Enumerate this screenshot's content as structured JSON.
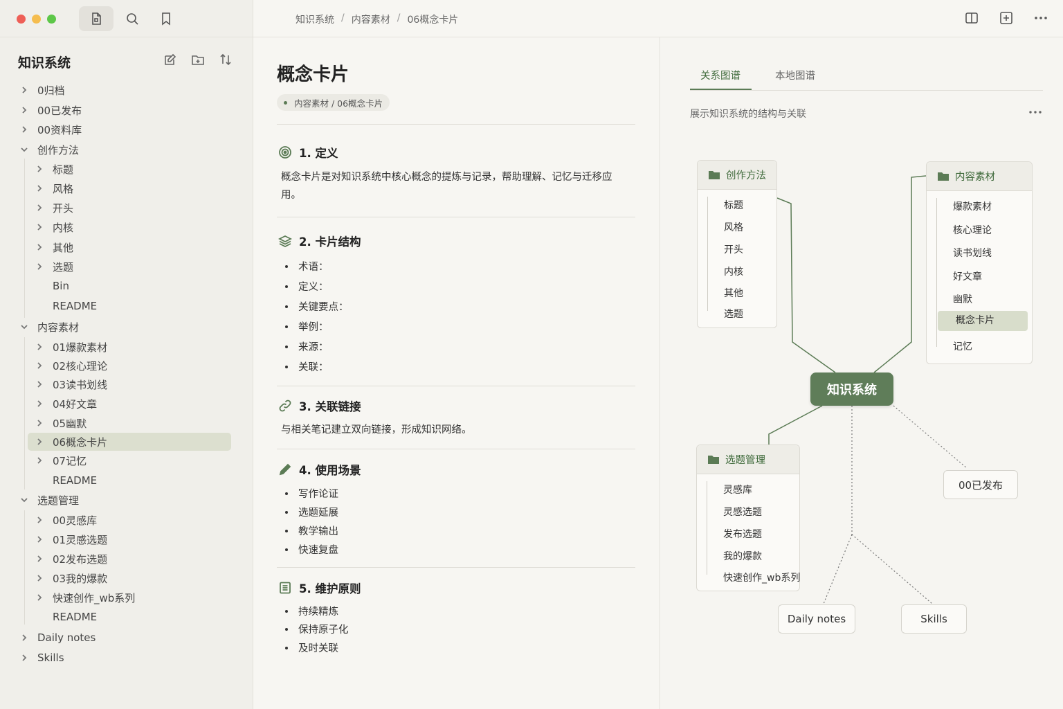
{
  "window": {
    "active_tool": "file-explorer"
  },
  "breadcrumb": [
    "知识系统",
    "内容素材",
    "06概念卡片"
  ],
  "sidebar": {
    "vault_title": "知识系统",
    "tree": [
      {
        "label": "0归档",
        "depth": 0,
        "chevron": "right"
      },
      {
        "label": "00已发布",
        "depth": 0,
        "chevron": "right"
      },
      {
        "label": "00资料库",
        "depth": 0,
        "chevron": "right"
      },
      {
        "label": "创作方法",
        "depth": 0,
        "chevron": "down"
      },
      {
        "label": "标题",
        "depth": 1,
        "chevron": "right"
      },
      {
        "label": "风格",
        "depth": 1,
        "chevron": "right"
      },
      {
        "label": "开头",
        "depth": 1,
        "chevron": "right"
      },
      {
        "label": "内核",
        "depth": 1,
        "chevron": "right"
      },
      {
        "label": "其他",
        "depth": 1,
        "chevron": "right"
      },
      {
        "label": "选题",
        "depth": 1,
        "chevron": "right"
      },
      {
        "label": "Bin",
        "depth": 1,
        "chevron": "none"
      },
      {
        "label": "README",
        "depth": 1,
        "chevron": "none"
      },
      {
        "label": "内容素材",
        "depth": 0,
        "chevron": "down"
      },
      {
        "label": "01爆款素材",
        "depth": 1,
        "chevron": "right"
      },
      {
        "label": "02核心理论",
        "depth": 1,
        "chevron": "right"
      },
      {
        "label": "03读书划线",
        "depth": 1,
        "chevron": "right"
      },
      {
        "label": "04好文章",
        "depth": 1,
        "chevron": "right"
      },
      {
        "label": "05幽默",
        "depth": 1,
        "chevron": "right"
      },
      {
        "label": "06概念卡片",
        "depth": 1,
        "chevron": "right",
        "selected": true
      },
      {
        "label": "07记忆",
        "depth": 1,
        "chevron": "right"
      },
      {
        "label": "README",
        "depth": 1,
        "chevron": "none"
      },
      {
        "label": "选题管理",
        "depth": 0,
        "chevron": "down"
      },
      {
        "label": "00灵感库",
        "depth": 1,
        "chevron": "right"
      },
      {
        "label": "01灵感选题",
        "depth": 1,
        "chevron": "right"
      },
      {
        "label": "02发布选题",
        "depth": 1,
        "chevron": "right"
      },
      {
        "label": "03我的爆款",
        "depth": 1,
        "chevron": "right"
      },
      {
        "label": "快速创作_wb系列",
        "depth": 1,
        "chevron": "right"
      },
      {
        "label": "README",
        "depth": 1,
        "chevron": "none"
      },
      {
        "label": "Daily notes",
        "depth": 0,
        "chevron": "right"
      },
      {
        "label": "Skills",
        "depth": 0,
        "chevron": "right"
      }
    ]
  },
  "note": {
    "title": "概念卡片",
    "path_pill": "内容素材 / 06概念卡片",
    "sections": [
      {
        "heading": "1. 定义",
        "icon": "target-icon",
        "text": "概念卡片是对知识系统中核心概念的提炼与记录，帮助理解、记忆与迁移应用。"
      },
      {
        "heading": "2. 卡片结构",
        "icon": "layers-icon",
        "bullets": [
          "术语：",
          "定义：",
          "关键要点：",
          "举例：",
          "来源：",
          "关联："
        ]
      },
      {
        "heading": "3. 关联链接",
        "icon": "link-icon",
        "text": "与相关笔记建立双向链接，形成知识网络。"
      },
      {
        "heading": "4. 使用场景",
        "icon": "pencil-icon",
        "bullets": [
          "写作论证",
          "选题延展",
          "教学输出",
          "快速复盘"
        ]
      },
      {
        "heading": "5. 维护原则",
        "icon": "list-doc-icon",
        "bullets": [
          "持续精炼",
          "保持原子化",
          "及时关联"
        ]
      }
    ]
  },
  "graph": {
    "tabs": [
      "关系图谱",
      "本地图谱"
    ],
    "active_tab": 0,
    "subtitle": "展示知识系统的结构与关联",
    "center": "知识系统",
    "cards": [
      {
        "title": "创作方法",
        "items": [
          "标题",
          "风格",
          "开头",
          "内核",
          "其他",
          "选题"
        ]
      },
      {
        "title": "内容素材",
        "items": [
          "爆款素材",
          "核心理论",
          "读书划线",
          "好文章",
          "幽默",
          "概念卡片",
          "记忆"
        ],
        "selected_index": 5
      },
      {
        "title": "选题管理",
        "items": [
          "灵感库",
          "灵感选题",
          "发布选题",
          "我的爆款",
          "快速创作_wb系列"
        ]
      }
    ],
    "leaves": [
      "00已发布",
      "Daily notes",
      "Skills"
    ]
  },
  "colors": {
    "accent": "#5b7b55",
    "selected_bg": "#dcdfcf",
    "center_node": "#5f7d59"
  }
}
